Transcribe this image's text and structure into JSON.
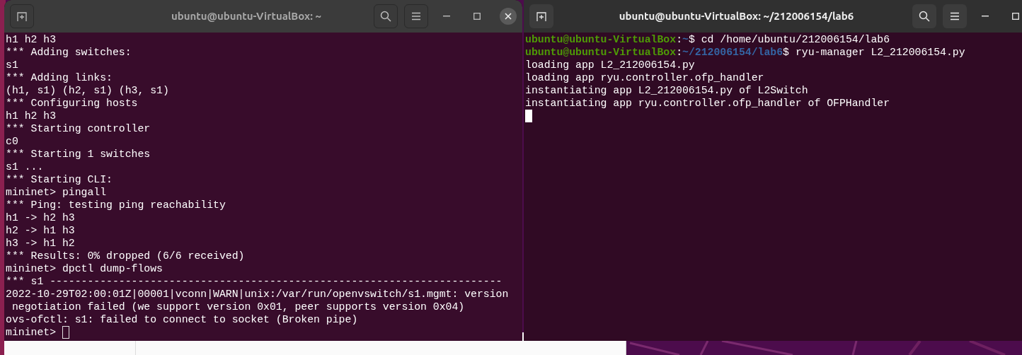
{
  "windows": [
    {
      "title": "ubuntu@ubuntu-VirtualBox: ~",
      "active": false,
      "controls": [
        {
          "kind": "new_tab"
        },
        {
          "kind": "search"
        },
        {
          "kind": "menu"
        },
        {
          "kind": "minimize"
        },
        {
          "kind": "maximize"
        },
        {
          "kind": "close"
        }
      ],
      "lines": [
        {
          "kind": "output",
          "text": "h1 h2 h3"
        },
        {
          "kind": "output",
          "text": "*** Adding switches:"
        },
        {
          "kind": "output",
          "text": "s1"
        },
        {
          "kind": "output",
          "text": "*** Adding links:"
        },
        {
          "kind": "output",
          "text": "(h1, s1) (h2, s1) (h3, s1)"
        },
        {
          "kind": "output",
          "text": "*** Configuring hosts"
        },
        {
          "kind": "output",
          "text": "h1 h2 h3"
        },
        {
          "kind": "output",
          "text": "*** Starting controller"
        },
        {
          "kind": "output",
          "text": "c0"
        },
        {
          "kind": "output",
          "text": "*** Starting 1 switches"
        },
        {
          "kind": "output",
          "text": "s1 ..."
        },
        {
          "kind": "output",
          "text": "*** Starting CLI:"
        },
        {
          "kind": "output",
          "text": "mininet> pingall"
        },
        {
          "kind": "output",
          "text": "*** Ping: testing ping reachability"
        },
        {
          "kind": "output",
          "text": "h1 -> h2 h3"
        },
        {
          "kind": "output",
          "text": "h2 -> h1 h3"
        },
        {
          "kind": "output",
          "text": "h3 -> h1 h2"
        },
        {
          "kind": "output",
          "text": "*** Results: 0% dropped (6/6 received)"
        },
        {
          "kind": "output",
          "text": "mininet> dpctl dump-flows"
        },
        {
          "kind": "output",
          "text": "*** s1 ------------------------------------------------------------------------"
        },
        {
          "kind": "output",
          "text": "2022-10-29T02:00:01Z|00001|vconn|WARN|unix:/var/run/openvswitch/s1.mgmt: version"
        },
        {
          "kind": "output",
          "text": " negotiation failed (we support version 0x01, peer supports version 0x04)"
        },
        {
          "kind": "output",
          "text": "ovs-ofctl: s1: failed to connect to socket (Broken pipe)"
        },
        {
          "kind": "input",
          "text": "mininet> "
        }
      ]
    },
    {
      "title": "ubuntu@ubuntu-VirtualBox: ~/212006154/lab6",
      "active": true,
      "controls": [
        {
          "kind": "new_tab"
        },
        {
          "kind": "search"
        },
        {
          "kind": "menu"
        },
        {
          "kind": "minimize"
        },
        {
          "kind": "maximize"
        }
      ],
      "lines": [
        {
          "kind": "prompt",
          "user": "ubuntu@ubuntu-VirtualBox",
          "sep": ":",
          "path": "~",
          "sigil": "$",
          "command": "cd /home/ubuntu/212006154/lab6"
        },
        {
          "kind": "prompt",
          "user": "ubuntu@ubuntu-VirtualBox",
          "sep": ":",
          "path": "~/212006154/lab6",
          "sigil": "$",
          "command": "ryu-manager L2_212006154.py"
        },
        {
          "kind": "output",
          "text": "loading app L2_212006154.py"
        },
        {
          "kind": "output",
          "text": "loading app ryu.controller.ofp_handler"
        },
        {
          "kind": "output",
          "text": "instantiating app L2_212006154.py of L2Switch"
        },
        {
          "kind": "output",
          "text": "instantiating app ryu.controller.ofp_handler of OFPHandler"
        },
        {
          "kind": "input"
        }
      ]
    }
  ]
}
